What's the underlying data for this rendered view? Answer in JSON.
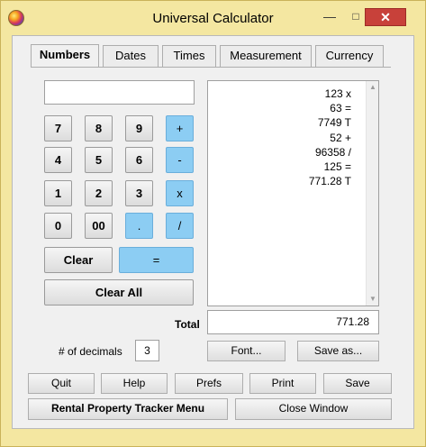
{
  "window": {
    "title": "Universal Calculator",
    "minimize": "—",
    "maximize": "□",
    "close": "✕"
  },
  "tabs": [
    "Numbers",
    "Dates",
    "Times",
    "Measurement",
    "Currency"
  ],
  "active_tab": "Numbers",
  "entry_value": "",
  "keypad": {
    "k7": "7",
    "k8": "8",
    "k9": "9",
    "plus": "+",
    "k4": "4",
    "k5": "5",
    "k6": "6",
    "minus": "-",
    "k1": "1",
    "k2": "2",
    "k3": "3",
    "times": "x",
    "k0": "0",
    "k00": "00",
    "dot": ".",
    "divide": "/",
    "clear": "Clear",
    "equals": "=",
    "clear_all": "Clear All"
  },
  "tape": {
    "lines": [
      "123 x",
      "63 =",
      "7749 T",
      "52 +",
      "96358 /",
      "125 =",
      "771.28 T"
    ]
  },
  "total": {
    "label": "Total",
    "value": "771.28"
  },
  "decimals": {
    "label": "# of decimals",
    "value": "3"
  },
  "buttons": {
    "font": "Font...",
    "save_as": "Save as...",
    "quit": "Quit",
    "help": "Help",
    "prefs": "Prefs",
    "print": "Print",
    "save": "Save",
    "rental_menu": "Rental Property Tracker Menu",
    "close_window": "Close Window"
  },
  "colors": {
    "title_bar": "#f4e7a1",
    "operator_key": "#8ccdf3",
    "close_button": "#c8413a"
  }
}
